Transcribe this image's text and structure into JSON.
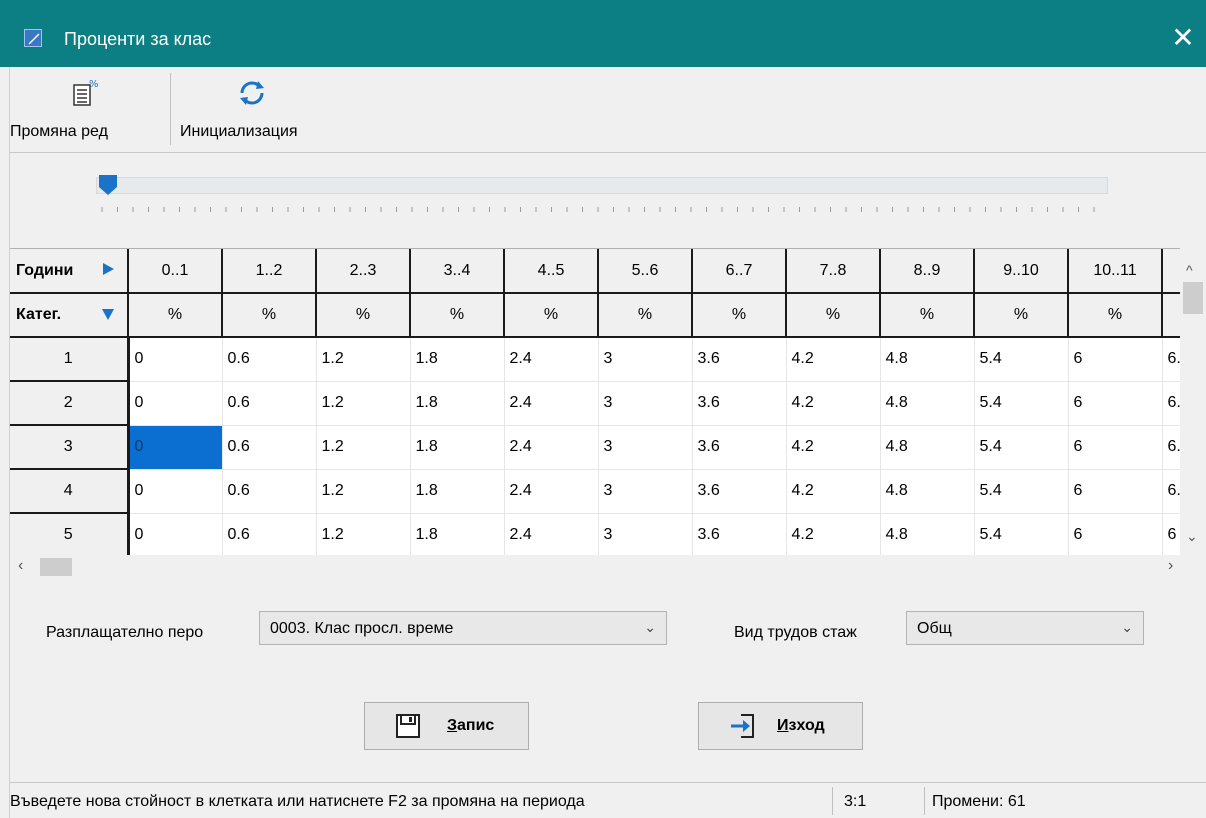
{
  "window": {
    "title": "Проценти за клас",
    "close_glyph": "✕"
  },
  "toolbar": {
    "change_row_label": "Промяна ред",
    "change_row_icon": "percent-document-icon",
    "init_label": "Инициализация",
    "init_icon": "refresh-icon"
  },
  "slider": {
    "value_fraction": 0.0
  },
  "grid": {
    "corner_top": "Години",
    "corner_bottom": "Катег.",
    "year_columns": [
      "0..1",
      "1..2",
      "2..3",
      "3..4",
      "4..5",
      "5..6",
      "6..7",
      "7..8",
      "8..9",
      "9..10",
      "10..11",
      ""
    ],
    "unit_row": [
      "%",
      "%",
      "%",
      "%",
      "%",
      "%",
      "%",
      "%",
      "%",
      "%",
      "%",
      ""
    ],
    "rows": [
      {
        "category": "1",
        "values": [
          "0",
          "0.6",
          "1.2",
          "1.8",
          "2.4",
          "3",
          "3.6",
          "4.2",
          "4.8",
          "5.4",
          "6",
          "6."
        ]
      },
      {
        "category": "2",
        "values": [
          "0",
          "0.6",
          "1.2",
          "1.8",
          "2.4",
          "3",
          "3.6",
          "4.2",
          "4.8",
          "5.4",
          "6",
          "6."
        ]
      },
      {
        "category": "3",
        "values": [
          "0",
          "0.6",
          "1.2",
          "1.8",
          "2.4",
          "3",
          "3.6",
          "4.2",
          "4.8",
          "5.4",
          "6",
          "6."
        ]
      },
      {
        "category": "4",
        "values": [
          "0",
          "0.6",
          "1.2",
          "1.8",
          "2.4",
          "3",
          "3.6",
          "4.2",
          "4.8",
          "5.4",
          "6",
          "6."
        ]
      },
      {
        "category": "5",
        "values": [
          "0",
          "0.6",
          "1.2",
          "1.8",
          "2.4",
          "3",
          "3.6",
          "4.2",
          "4.8",
          "5.4",
          "6",
          "6"
        ]
      }
    ],
    "selected": {
      "row": 3,
      "col": 1
    }
  },
  "form": {
    "pay_item_label": "Разплащателно перо",
    "pay_item_value": "0003. Клас просл. време",
    "seniority_label": "Вид трудов стаж",
    "seniority_value": "Общ"
  },
  "buttons": {
    "save_label": "Запис",
    "save_underline": "З",
    "save_rest": "апис",
    "exit_label": "Изход",
    "exit_underline": "И",
    "exit_rest": "зход"
  },
  "status": {
    "message": "Въведете нова стойност в клетката или натиснете F2 за промяна на периода",
    "position": "3:1",
    "changes": "Промени: 61"
  },
  "colors": {
    "titlebar": "#0b7f83",
    "selection": "#0a6fd1",
    "accent": "#1a73c8"
  }
}
